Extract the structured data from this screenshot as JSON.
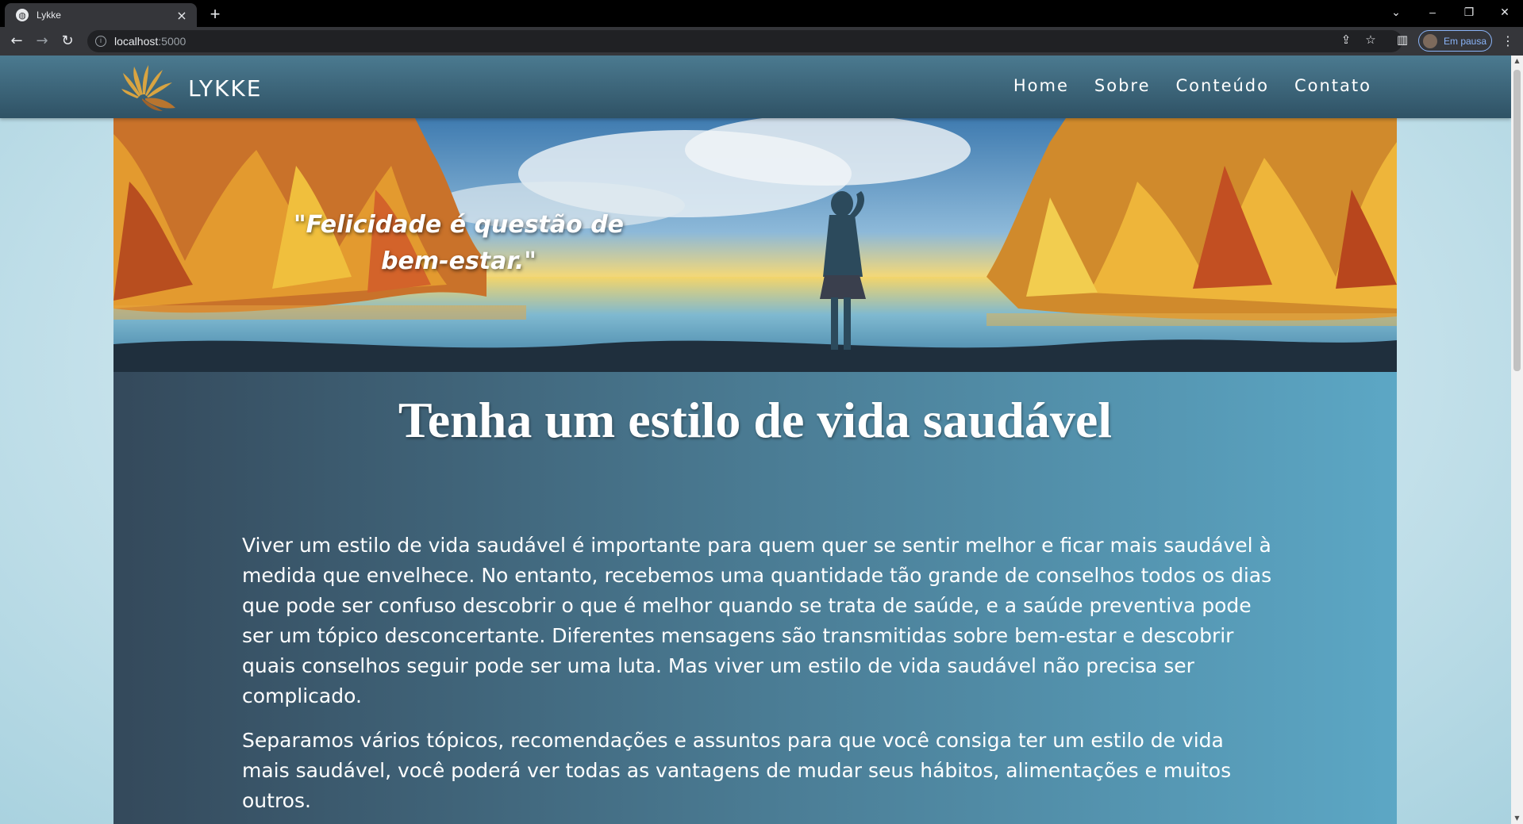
{
  "browser": {
    "tab_title": "Lykke",
    "url_host": "localhost",
    "url_port": ":5000",
    "profile_label": "Em pausa"
  },
  "site": {
    "brand_name": "LYKKE",
    "nav": [
      "Home",
      "Sobre",
      "Conteúdo",
      "Contato"
    ],
    "hero_quote_line1": "\"Felicidade é questão de",
    "hero_quote_line2": "bem-estar.\"",
    "title": "Tenha um estilo de vida saudável",
    "paragraphs": [
      "Viver um estilo de vida saudável é importante para quem quer se sentir melhor e ficar mais saudável à medida que envelhece. No entanto, recebemos uma quantidade tão grande de conselhos todos os dias que pode ser confuso descobrir o que é melhor quando se trata de saúde, e a saúde preventiva pode ser um tópico desconcertante. Diferentes mensagens são transmitidas sobre bem-estar e descobrir quais conselhos seguir pode ser uma luta. Mas viver um estilo de vida saudável não precisa ser complicado.",
      "Separamos vários tópicos, recomendações e assuntos para que você consiga ter um estilo de vida mais saudável, você poderá ver todas as vantagens de mudar seus hábitos, alimentações e muitos outros."
    ]
  },
  "icons": {
    "favicon": "globe-icon",
    "back": "arrow-left-icon",
    "forward": "arrow-right-icon",
    "reload": "reload-icon",
    "share": "share-icon",
    "bookmark": "star-icon",
    "sidepanel": "side-panel-icon",
    "menu": "kebab-menu-icon",
    "logo": "leaf-fan-logo"
  },
  "colors": {
    "header_top": "#4b7a90",
    "header_bottom": "#2f5265",
    "content_left": "#34495b",
    "content_right": "#5ca7c5",
    "logo_gold": "#d9a441"
  }
}
